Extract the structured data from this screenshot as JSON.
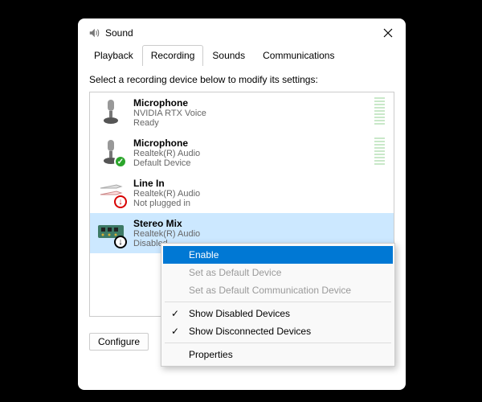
{
  "window": {
    "title": "Sound"
  },
  "tabs": {
    "playback": "Playback",
    "recording": "Recording",
    "sounds": "Sounds",
    "communications": "Communications",
    "active": "recording"
  },
  "instruction": "Select a recording device below to modify its settings:",
  "devices": [
    {
      "name": "Microphone",
      "desc": "NVIDIA RTX Voice",
      "status": "Ready"
    },
    {
      "name": "Microphone",
      "desc": "Realtek(R) Audio",
      "status": "Default Device"
    },
    {
      "name": "Line In",
      "desc": "Realtek(R) Audio",
      "status": "Not plugged in"
    },
    {
      "name": "Stereo Mix",
      "desc": "Realtek(R) Audio",
      "status": "Disabled"
    }
  ],
  "buttons": {
    "configure": "Configure"
  },
  "contextMenu": {
    "enable": "Enable",
    "setDefault": "Set as Default Device",
    "setDefaultComm": "Set as Default Communication Device",
    "showDisabled": "Show Disabled Devices",
    "showDisconnected": "Show Disconnected Devices",
    "properties": "Properties"
  }
}
